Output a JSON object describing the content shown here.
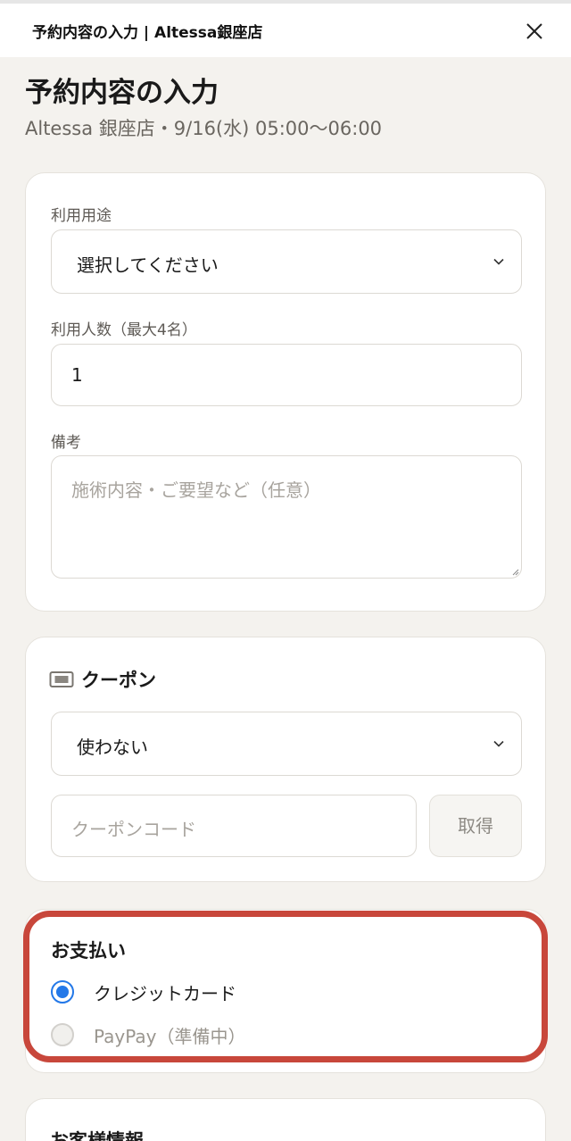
{
  "header": {
    "title": "予約内容の入力 | Altessa銀座店",
    "close_icon": "close-icon"
  },
  "page": {
    "title": "予約内容の入力",
    "subtitle": "Altessa 銀座店・9/16(水) 05:00〜06:00"
  },
  "form": {
    "purpose_label": "利用用途",
    "purpose_value": "選択してください",
    "people_label": "利用人数（最大4名）",
    "people_value": "1",
    "notes_label": "備考",
    "notes_placeholder": "施術内容・ご要望など（任意）"
  },
  "coupon": {
    "icon": "ticket-icon",
    "title": "クーポン",
    "select_value": "使わない",
    "code_placeholder": "クーポンコード",
    "get_button": "取得"
  },
  "payment": {
    "title": "お支払い",
    "options": [
      {
        "label": "クレジットカード",
        "selected": true
      },
      {
        "label": "PayPay（準備中）",
        "selected": false
      }
    ],
    "highlight_color": "#c8473b",
    "accent_color": "#2378e8"
  },
  "customer": {
    "title": "お客様情報"
  }
}
